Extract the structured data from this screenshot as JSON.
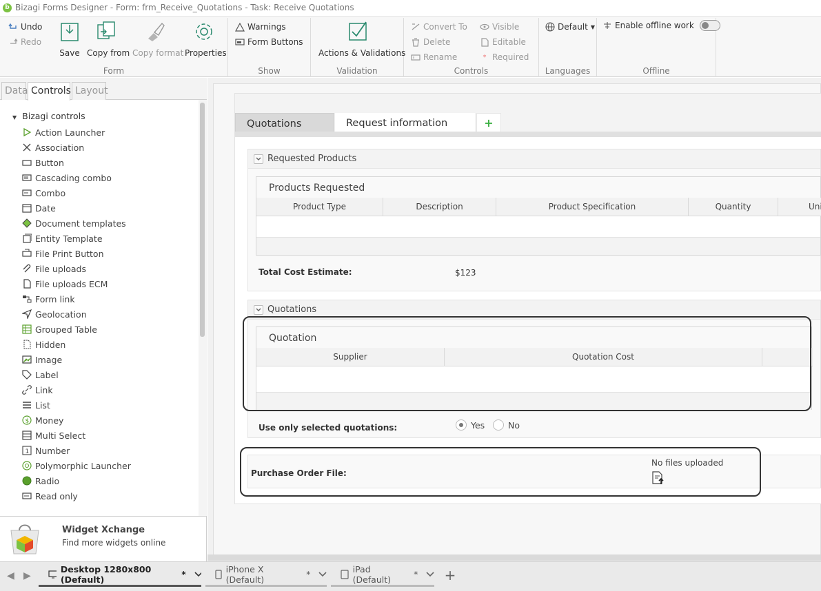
{
  "window": {
    "title": "Bizagi Forms Designer  - Form: frm_Receive_Quotations - Task:  Receive Quotations"
  },
  "ribbon": {
    "undo": "Undo",
    "redo": "Redo",
    "save": "Save",
    "copy_from": "Copy from",
    "copy_format": "Copy format",
    "properties": "Properties",
    "form_group": "Form",
    "warnings": "Warnings",
    "form_buttons": "Form Buttons",
    "show_group": "Show",
    "actions_validations": "Actions & Validations",
    "validation_group": "Validation",
    "convert_to": "Convert To",
    "delete": "Delete",
    "rename": "Rename",
    "visible": "Visible",
    "editable": "Editable",
    "required": "Required",
    "controls_group": "Controls",
    "language": "Default",
    "languages_group": "Languages",
    "offline": "Enable offline work",
    "offline_group": "Offline"
  },
  "left_panel": {
    "tabs": [
      "Data",
      "Controls",
      "Layout"
    ],
    "active_tab": "Controls",
    "tree_root": "Bizagi controls",
    "items": [
      {
        "label": "Action Launcher",
        "icon": "play-icon"
      },
      {
        "label": "Association",
        "icon": "association-icon"
      },
      {
        "label": "Button",
        "icon": "button-icon"
      },
      {
        "label": "Cascading combo",
        "icon": "cascading-combo-icon"
      },
      {
        "label": "Combo",
        "icon": "combo-icon"
      },
      {
        "label": "Date",
        "icon": "date-icon"
      },
      {
        "label": "Document templates",
        "icon": "document-template-icon"
      },
      {
        "label": "Entity Template",
        "icon": "entity-template-icon"
      },
      {
        "label": "File Print Button",
        "icon": "print-button-icon"
      },
      {
        "label": "File uploads",
        "icon": "paperclip-icon"
      },
      {
        "label": "File uploads ECM",
        "icon": "file-ecm-icon"
      },
      {
        "label": "Form link",
        "icon": "form-link-icon"
      },
      {
        "label": "Geolocation",
        "icon": "geolocation-icon"
      },
      {
        "label": "Grouped Table",
        "icon": "grouped-table-icon"
      },
      {
        "label": "Hidden",
        "icon": "hidden-icon"
      },
      {
        "label": "Image",
        "icon": "image-icon"
      },
      {
        "label": "Label",
        "icon": "label-icon"
      },
      {
        "label": "Link",
        "icon": "link-icon"
      },
      {
        "label": "List",
        "icon": "list-icon"
      },
      {
        "label": "Money",
        "icon": "money-icon"
      },
      {
        "label": "Multi Select",
        "icon": "multi-select-icon"
      },
      {
        "label": "Number",
        "icon": "number-icon"
      },
      {
        "label": "Polymorphic Launcher",
        "icon": "polymorphic-icon"
      },
      {
        "label": "Radio",
        "icon": "radio-icon"
      },
      {
        "label": "Read only",
        "icon": "read-only-icon"
      }
    ],
    "widget_title": "Widget Xchange",
    "widget_subtitle": "Find more widgets online"
  },
  "form": {
    "tabs": [
      "Quotations",
      "Request information"
    ],
    "active_tab": "Quotations",
    "section1": {
      "title": "Requested Products",
      "grid_title": "Products Requested",
      "columns": [
        "Product Type",
        "Description",
        "Product Specification",
        "Quantity",
        "Uni"
      ],
      "total_label": "Total Cost Estimate:",
      "total_value": "$123"
    },
    "section2": {
      "title": "Quotations",
      "grid_title": "Quotation",
      "columns": [
        "Supplier",
        "Quotation Cost"
      ],
      "radio_label": "Use only selected quotations:",
      "radio_yes": "Yes",
      "radio_no": "No",
      "selected": "Yes"
    },
    "purchase_order": {
      "label": "Purchase Order File:",
      "status": "No files uploaded"
    }
  },
  "bottom_bar": {
    "devices": [
      "Desktop 1280x800 (Default)",
      "iPhone X (Default)",
      "iPad (Default)"
    ],
    "active_device": "Desktop 1280x800 (Default)",
    "modified_marker": "*"
  },
  "colors": {
    "accent": "#7cc242",
    "highlight_border": "#333333"
  }
}
